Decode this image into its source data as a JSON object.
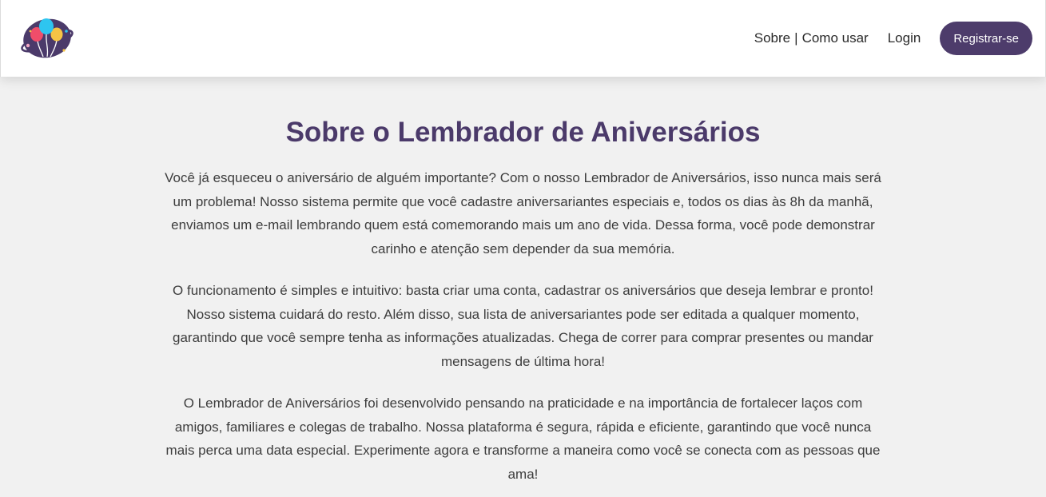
{
  "nav": {
    "about_label": "Sobre",
    "separator": "|",
    "how_to_label": "Como usar",
    "login_label": "Login",
    "register_label": "Registrar-se"
  },
  "logo": {
    "icon": "balloons-logo-icon",
    "colors": {
      "circle": "#4b3a6a",
      "balloon_blue": "#2ec5f0",
      "balloon_red": "#f04d6a",
      "balloon_yellow": "#f6c445",
      "balloon_pink": "#f2a7c4"
    }
  },
  "main": {
    "title": "Sobre o Lembrador de Aniversários",
    "paragraphs": [
      "Você já esqueceu o aniversário de alguém importante? Com o nosso Lembrador de Aniversários, isso nunca mais será um problema! Nosso sistema permite que você cadastre aniversariantes especiais e, todos os dias às 8h da manhã, enviamos um e-mail lembrando quem está comemorando mais um ano de vida. Dessa forma, você pode demonstrar carinho e atenção sem depender da sua memória.",
      "O funcionamento é simples e intuitivo: basta criar uma conta, cadastrar os aniversários que deseja lembrar e pronto! Nosso sistema cuidará do resto. Além disso, sua lista de aniversariantes pode ser editada a qualquer momento, garantindo que você sempre tenha as informações atualizadas. Chega de correr para comprar presentes ou mandar mensagens de última hora!",
      "O Lembrador de Aniversários foi desenvolvido pensando na praticidade e na importância de fortalecer laços com amigos, familiares e colegas de trabalho. Nossa plataforma é segura, rápida e eficiente, garantindo que você nunca mais perca uma data especial. Experimente agora e transforme a maneira como você se conecta com as pessoas que ama!"
    ]
  },
  "theme": {
    "accent": "#4d3c6b",
    "background": "#f1f1f1"
  }
}
